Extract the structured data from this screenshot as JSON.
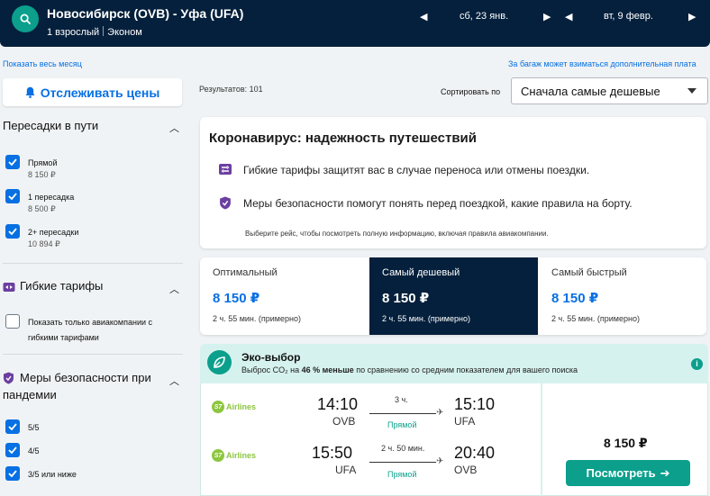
{
  "header": {
    "route": "Новосибирск (OVB) - Уфа (UFA)",
    "passengers": "1 взрослый",
    "cabin": "Эконом",
    "depart_date": "сб, 23 янв.",
    "return_date": "вт, 9 февр."
  },
  "links": {
    "show_month": "Показать весь месяц",
    "baggage_note": "За багаж может взиматься дополнительная плата"
  },
  "sidebar": {
    "track_button": "Отслеживать цены",
    "stops": {
      "title": "Пересадки в пути",
      "options": [
        {
          "label": "Прямой",
          "price": "8 150 ₽"
        },
        {
          "label": "1 пересадка",
          "price": "8 500 ₽"
        },
        {
          "label": "2+ пересадки",
          "price": "10 894 ₽"
        }
      ]
    },
    "flexible": {
      "title": "Гибкие тарифы",
      "option_line1": "Показать только авиакомпании с",
      "option_line2": "гибкими тарифами"
    },
    "safety": {
      "title_line1": "Меры безопасности при",
      "title_line2": "пандемии",
      "options": [
        "5/5",
        "4/5",
        "3/5 или ниже"
      ]
    }
  },
  "toolbar": {
    "results": "Результатов: 101",
    "sort_label": "Сортировать по",
    "sort_value": "Сначала самые дешевые"
  },
  "covid": {
    "title": "Коронавирус: надежность путешествий",
    "row1": "Гибкие тарифы защитят вас в случае переноса или отмены поездки.",
    "row2": "Меры безопасности помогут понять перед поездкой, какие правила на борту.",
    "footnote": "Выберите рейс, чтобы посмотреть полную информацию, включая правила авиакомпании."
  },
  "tabs": [
    {
      "name": "Оптимальный",
      "price": "8 150 ₽",
      "duration": "2 ч. 55 мин. (примерно)"
    },
    {
      "name": "Самый дешевый",
      "price": "8 150 ₽",
      "duration": "2 ч. 55 мин. (примерно)"
    },
    {
      "name": "Самый быстрый",
      "price": "8 150 ₽",
      "duration": "2 ч. 55 мин. (примерно)"
    }
  ],
  "eco": {
    "title": "Эко-выбор",
    "sub_prefix": "Выброс CO₂ на",
    "sub_bold": "46 % меньше",
    "sub_suffix": "по сравнению со средним показателем для вашего поиска"
  },
  "flight": {
    "airline": "Airlines",
    "airline_logo": "S7",
    "legs": [
      {
        "dep_time": "14:10",
        "dep_code": "OVB",
        "duration": "3 ч.",
        "stops": "Прямой",
        "arr_time": "15:10",
        "arr_code": "UFA"
      },
      {
        "dep_time": "15:50",
        "dep_code": "UFA",
        "duration": "2 ч. 50 мин.",
        "stops": "Прямой",
        "arr_time": "20:40",
        "arr_code": "OVB"
      }
    ],
    "price": "8 150 ₽",
    "view_button": "Посмотреть"
  },
  "colors": {
    "navy": "#05203c",
    "teal": "#0b9f8c",
    "blue": "#0770e3"
  }
}
